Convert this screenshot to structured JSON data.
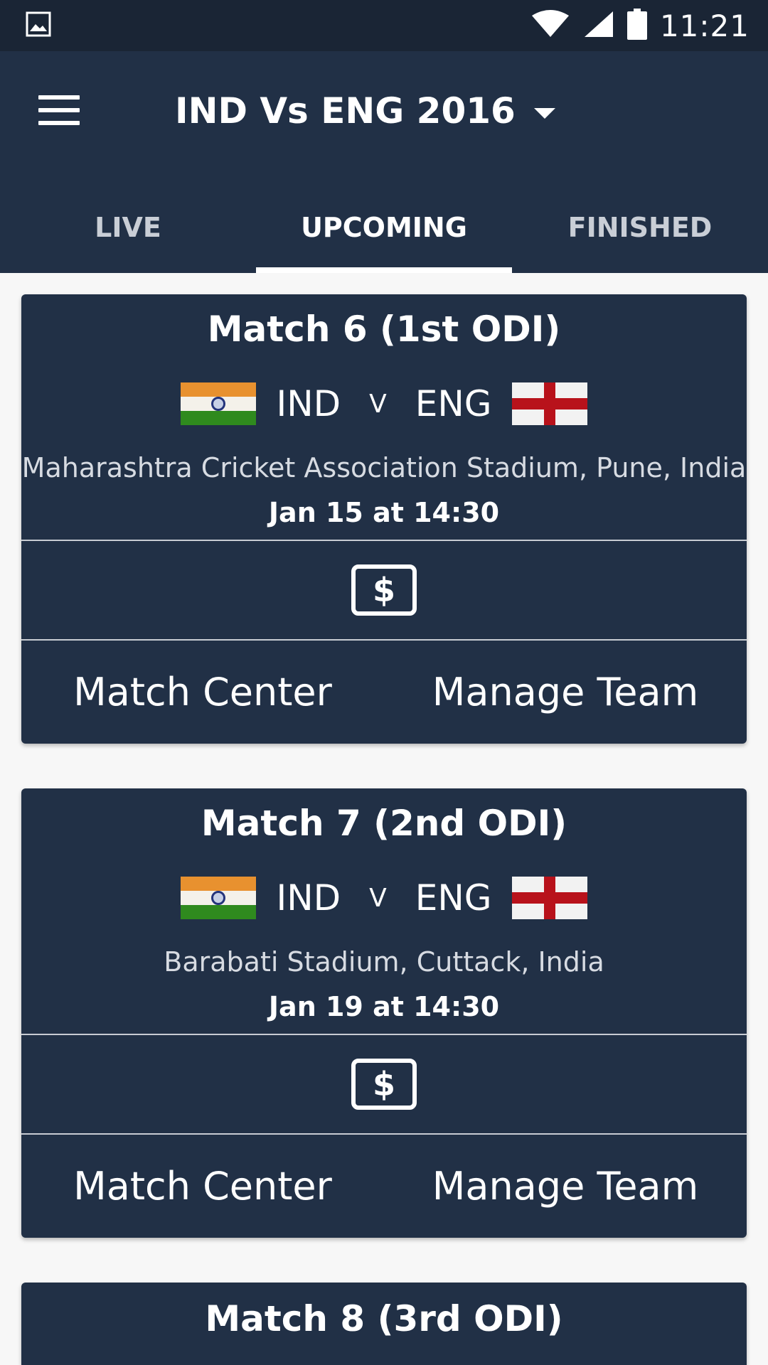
{
  "status_bar": {
    "time": "11:21",
    "icons": [
      "image-icon",
      "wifi-icon",
      "signal-icon",
      "battery-icon"
    ]
  },
  "app_bar": {
    "title": "IND Vs ENG 2016",
    "menu_icon": "hamburger-menu-icon",
    "dropdown_icon": "caret-down-icon"
  },
  "tabs": [
    {
      "label": "LIVE",
      "active": false
    },
    {
      "label": "UPCOMING",
      "active": true
    },
    {
      "label": "FINISHED",
      "active": false
    }
  ],
  "matches": [
    {
      "title": "Match 6 (1st ODI)",
      "team1": "IND",
      "vs": "V",
      "team2": "ENG",
      "venue": "Maharashtra Cricket Association Stadium, Pune, India",
      "datetime": "Jan 15 at 14:30",
      "icon_symbol": "$",
      "action_left": "Match Center",
      "action_right": "Manage Team"
    },
    {
      "title": "Match 7 (2nd ODI)",
      "team1": "IND",
      "vs": "V",
      "team2": "ENG",
      "venue": "Barabati Stadium, Cuttack, India",
      "datetime": "Jan 19 at 14:30",
      "icon_symbol": "$",
      "action_left": "Match Center",
      "action_right": "Manage Team"
    },
    {
      "title": "Match 8 (3rd ODI)"
    }
  ],
  "colors": {
    "status_bar": "#1a2535",
    "app_bar": "#213046",
    "card": "#213046",
    "background": "#f7f7f7",
    "india_saffron": "#e8912f",
    "india_green": "#2f8a1e",
    "england_red": "#b8121b"
  }
}
